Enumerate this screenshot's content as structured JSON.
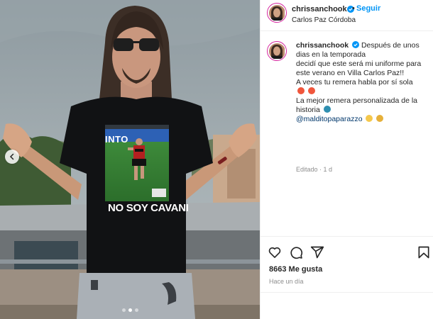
{
  "header": {
    "username": "chrissanchook",
    "separator": "•",
    "follow_label": "Seguir",
    "location": "Carlos Paz Córdoba"
  },
  "photo": {
    "shirt_text": "NO SOY CAVANI",
    "shirt_banner_text": "INTO",
    "carousel_count": 3,
    "carousel_active_index": 1
  },
  "caption": {
    "username": "chrissanchook",
    "line1": "Después de unos",
    "line2": "dias en la temporada",
    "line3": "decidí que este será mi uniforme para",
    "line4": "este verano en Villa Carlos Paz!!",
    "line5": "A veces tu remera habla por sí sola",
    "line6": "La mejor remera personalizada de la",
    "line7": "historia",
    "mention": "@malditopaparazzo",
    "edited": "Editado · 1 d"
  },
  "actions": {
    "likes": "8663 Me gusta",
    "time_ago": "Hace un día"
  },
  "colors": {
    "accent": "#0095f6",
    "verified": "#0095f6",
    "text": "#262626",
    "muted": "#8e8e8e",
    "mention": "#00376b"
  },
  "icons": [
    "verified-badge-icon",
    "more-options-icon",
    "chevron-left-icon",
    "heart-icon",
    "comment-icon",
    "share-icon",
    "bookmark-icon"
  ]
}
